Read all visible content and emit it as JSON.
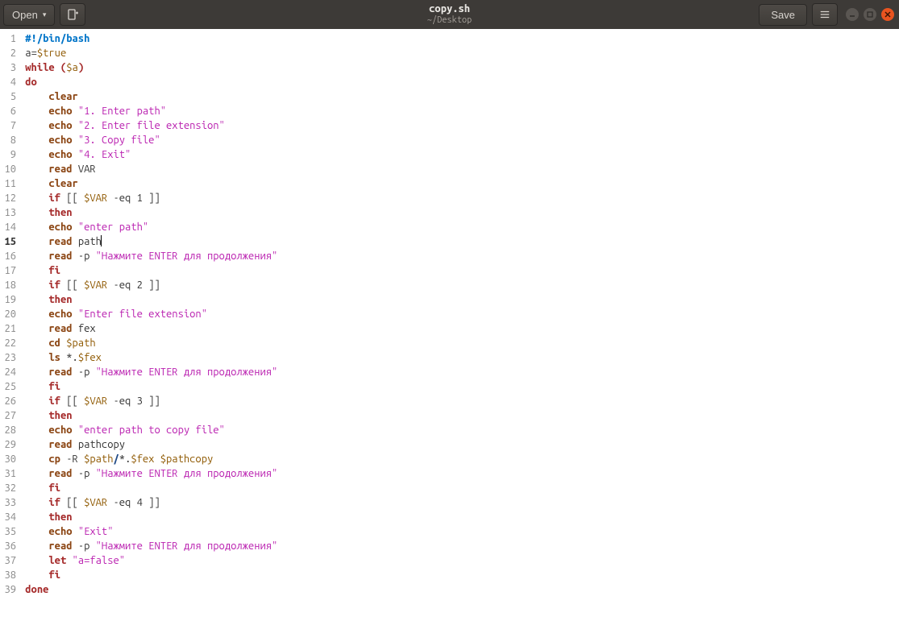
{
  "toolbar": {
    "open_label": "Open",
    "save_label": "Save"
  },
  "title": {
    "filename": "copy.sh",
    "path": "~/Desktop"
  },
  "icons": {
    "new_doc": "new-document-icon",
    "hamburger": "menu-icon",
    "minimize": "minimize-icon",
    "maximize": "maximize-icon",
    "close": "close-icon"
  },
  "code": {
    "current_line": 15,
    "lines": [
      {
        "n": 1,
        "raw": "#!/bin/bash"
      },
      {
        "n": 2,
        "raw": "a=$true"
      },
      {
        "n": 3,
        "raw": "while ($a)"
      },
      {
        "n": 4,
        "raw": "do"
      },
      {
        "n": 5,
        "raw": "    clear"
      },
      {
        "n": 6,
        "raw": "    echo \"1. Enter path\""
      },
      {
        "n": 7,
        "raw": "    echo \"2. Enter file extension\""
      },
      {
        "n": 8,
        "raw": "    echo \"3. Copy file\""
      },
      {
        "n": 9,
        "raw": "    echo \"4. Exit\""
      },
      {
        "n": 10,
        "raw": "    read VAR"
      },
      {
        "n": 11,
        "raw": "    clear"
      },
      {
        "n": 12,
        "raw": "    if [[ $VAR -eq 1 ]]"
      },
      {
        "n": 13,
        "raw": "    then"
      },
      {
        "n": 14,
        "raw": "    echo \"enter path\""
      },
      {
        "n": 15,
        "raw": "    read path"
      },
      {
        "n": 16,
        "raw": "    read -p \"Нажмите ENTER для продолжения\""
      },
      {
        "n": 17,
        "raw": "    fi"
      },
      {
        "n": 18,
        "raw": "    if [[ $VAR -eq 2 ]]"
      },
      {
        "n": 19,
        "raw": "    then"
      },
      {
        "n": 20,
        "raw": "    echo \"Enter file extension\""
      },
      {
        "n": 21,
        "raw": "    read fex"
      },
      {
        "n": 22,
        "raw": "    cd $path"
      },
      {
        "n": 23,
        "raw": "    ls *.$fex"
      },
      {
        "n": 24,
        "raw": "    read -p \"Нажмите ENTER для продолжения\""
      },
      {
        "n": 25,
        "raw": "    fi"
      },
      {
        "n": 26,
        "raw": "    if [[ $VAR -eq 3 ]]"
      },
      {
        "n": 27,
        "raw": "    then"
      },
      {
        "n": 28,
        "raw": "    echo \"enter path to copy file\""
      },
      {
        "n": 29,
        "raw": "    read pathcopy"
      },
      {
        "n": 30,
        "raw": "    cp -R $path/*.$fex $pathcopy"
      },
      {
        "n": 31,
        "raw": "    read -p \"Нажмите ENTER для продолжения\""
      },
      {
        "n": 32,
        "raw": "    fi"
      },
      {
        "n": 33,
        "raw": "    if [[ $VAR -eq 4 ]]"
      },
      {
        "n": 34,
        "raw": "    then"
      },
      {
        "n": 35,
        "raw": "    echo \"Exit\""
      },
      {
        "n": 36,
        "raw": "    read -p \"Нажмите ENTER для продолжения\""
      },
      {
        "n": 37,
        "raw": "    let \"a=false\""
      },
      {
        "n": 38,
        "raw": "    fi"
      },
      {
        "n": 39,
        "raw": "done"
      }
    ]
  }
}
